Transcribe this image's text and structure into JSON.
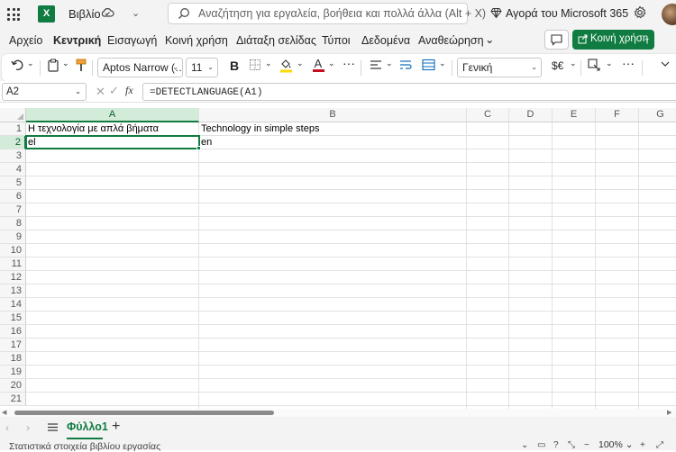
{
  "app": {
    "logo_letter": "X",
    "workbook_name": "Βιβλίο",
    "search_placeholder": "Αναζήτηση για εργαλεία, βοήθεια και πολλά άλλα (Alt + X)",
    "buy_link": "Αγορά του Microsoft 365",
    "brand_color": "#107c41"
  },
  "menu": {
    "tabs": [
      "Αρχείο",
      "Κεντρική",
      "Εισαγωγή",
      "Κοινή χρήση",
      "Διάταξη σελίδας",
      "Τύποι",
      "Δεδομένα",
      "Αναθεώρηση"
    ],
    "active_tab": "Κεντρική",
    "share_label": "Κοινή χρήση"
  },
  "toolbar": {
    "font_name": "Aptos Narrow (…",
    "font_size": "11",
    "bold_label": "B",
    "number_format": "Γενική",
    "currency_label": "$€",
    "more_label": "···",
    "font_color": "#c50f1f",
    "fill_color": "#ffd800"
  },
  "formula_bar": {
    "name_box": "A2",
    "fx_label": "fx",
    "formula": "=DETECTLANGUAGE(A1)"
  },
  "grid": {
    "columns": [
      "A",
      "B",
      "C",
      "D",
      "E",
      "F",
      "G"
    ],
    "selected_column": "A",
    "rows": [
      "1",
      "2",
      "3",
      "4",
      "5",
      "6",
      "7",
      "8",
      "9",
      "10",
      "11",
      "12",
      "13",
      "14",
      "15",
      "16",
      "17",
      "18",
      "19",
      "20",
      "21"
    ],
    "selected_row": "2",
    "cells": {
      "A1": "Η τεχνολογία με απλά βήματα",
      "B1": "Technology in simple steps",
      "A2": "el",
      "B2": "en"
    }
  },
  "sheets": {
    "active": "Φύλλο1",
    "add_label": "+"
  },
  "status": {
    "text": "Στατιστικά στοιχεία βιβλίου εργασίας",
    "zoom": "100%"
  }
}
